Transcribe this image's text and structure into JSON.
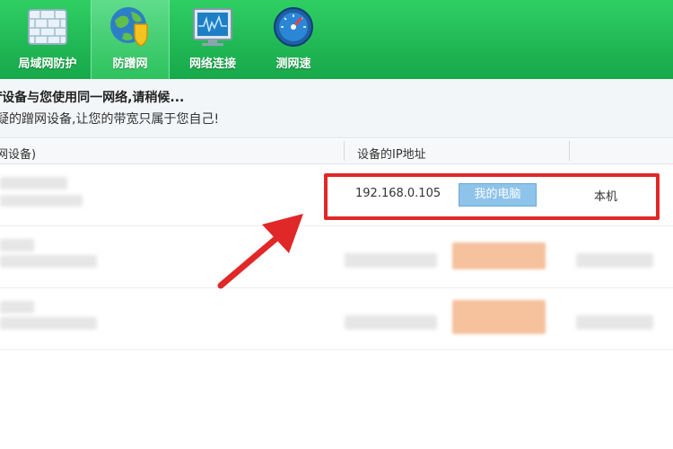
{
  "toolbar": {
    "items": [
      {
        "label": "局域网防护",
        "icon": "firewall-brick-icon"
      },
      {
        "label": "防蹭网",
        "icon": "globe-shield-icon"
      },
      {
        "label": "网络连接",
        "icon": "network-monitor-icon"
      },
      {
        "label": "测网速",
        "icon": "speedometer-icon"
      }
    ]
  },
  "hint": {
    "line1": "f设备与您使用同一网络,请稍候...",
    "line2": "疑的蹭网设备,让您的带宽只属于您自己!"
  },
  "table": {
    "col_device": "网设备)",
    "col_ip": "设备的IP地址"
  },
  "my_device": {
    "ip": "192.168.0.105",
    "badge": "我的电脑",
    "remark": "本机"
  },
  "colors": {
    "toolbar_green": "#1db352",
    "highlight_red": "#e02828",
    "badge_blue": "#8ec3ea"
  }
}
